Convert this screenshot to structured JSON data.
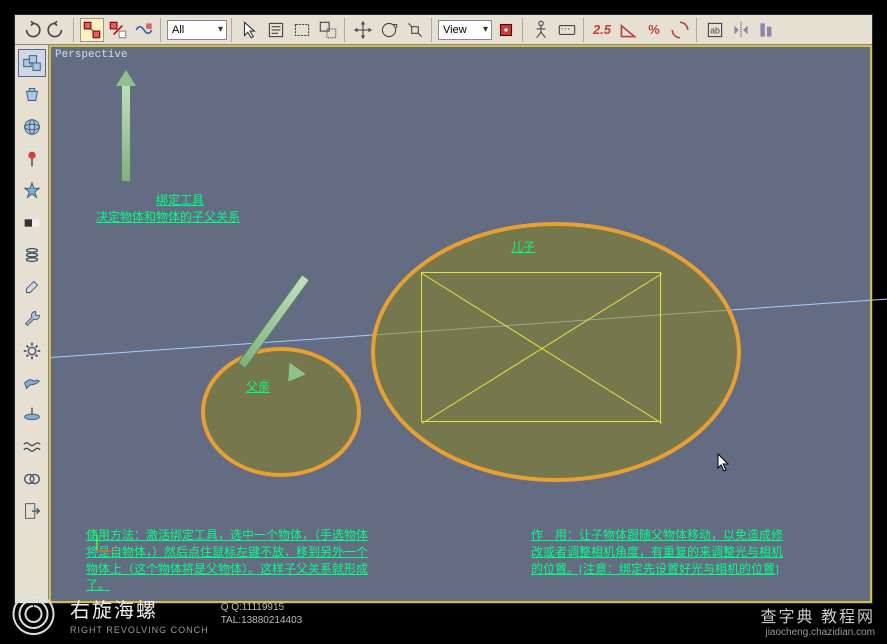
{
  "viewport": {
    "label": "Perspective"
  },
  "toolbar": {
    "selection_filter": "All",
    "named_sets": "View",
    "snap_value": "2.5"
  },
  "annotations": {
    "tool_title": "绑定工具",
    "tool_desc": "决定物体和物体的子父关系",
    "son_label": "儿子",
    "father_label": "父亲",
    "usage_title": "使用方法：",
    "usage_body": "激活绑定工具，选中一个物体，（手选物体将是自物体，）然后点住鼠标左键不放，移到另外一个物体上（这个物体将是父物体）。这样子父关系就形成了。",
    "purpose_title": "作　用：",
    "purpose_body": "让子物体跟随父物体移动，以免造成修改或者调整相机角度，有重复的来调整光与相机的位置。[注意：绑定先设置好光与相机的位置]"
  },
  "brand": {
    "title": "右旋海螺",
    "sub": "RIGHT REVOLVING CONCH",
    "qq": "Q Q:11119915",
    "tel": "TAL:13880214403"
  },
  "watermark": {
    "line1": "查字典 教程网",
    "line2": "jiaocheng.chazidian.com"
  },
  "colors": {
    "viewport_bg": "#646c84",
    "highlight": "#e8a030",
    "anno_green": "#00ff80",
    "wire_yellow": "#e8e040"
  }
}
